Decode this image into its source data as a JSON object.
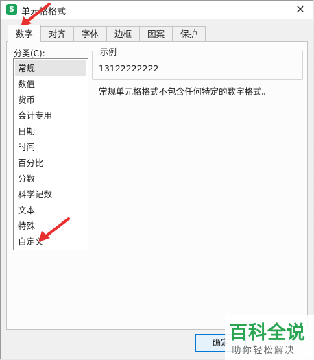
{
  "dialog": {
    "title": "单元格格式",
    "app_icon_letter": "S",
    "close_glyph": "✕"
  },
  "tabs": [
    {
      "label": "数字",
      "active": true
    },
    {
      "label": "对齐"
    },
    {
      "label": "字体"
    },
    {
      "label": "边框"
    },
    {
      "label": "图案"
    },
    {
      "label": "保护"
    }
  ],
  "category": {
    "label": "分类(C):",
    "items": [
      "常规",
      "数值",
      "货币",
      "会计专用",
      "日期",
      "时间",
      "百分比",
      "分数",
      "科学记数",
      "文本",
      "特殊",
      "自定义"
    ],
    "selected": "常规"
  },
  "sample": {
    "legend": "示例",
    "value": "13122222222"
  },
  "description": "常规单元格格式不包含任何特定的数字格式。",
  "buttons": {
    "ok": "确定"
  },
  "watermark": {
    "big": "百科全说",
    "small": "助你轻松解决"
  },
  "colors": {
    "arrow": "#e8312f",
    "brand_green": "#2aa653",
    "selection": "#e5e5e5"
  }
}
